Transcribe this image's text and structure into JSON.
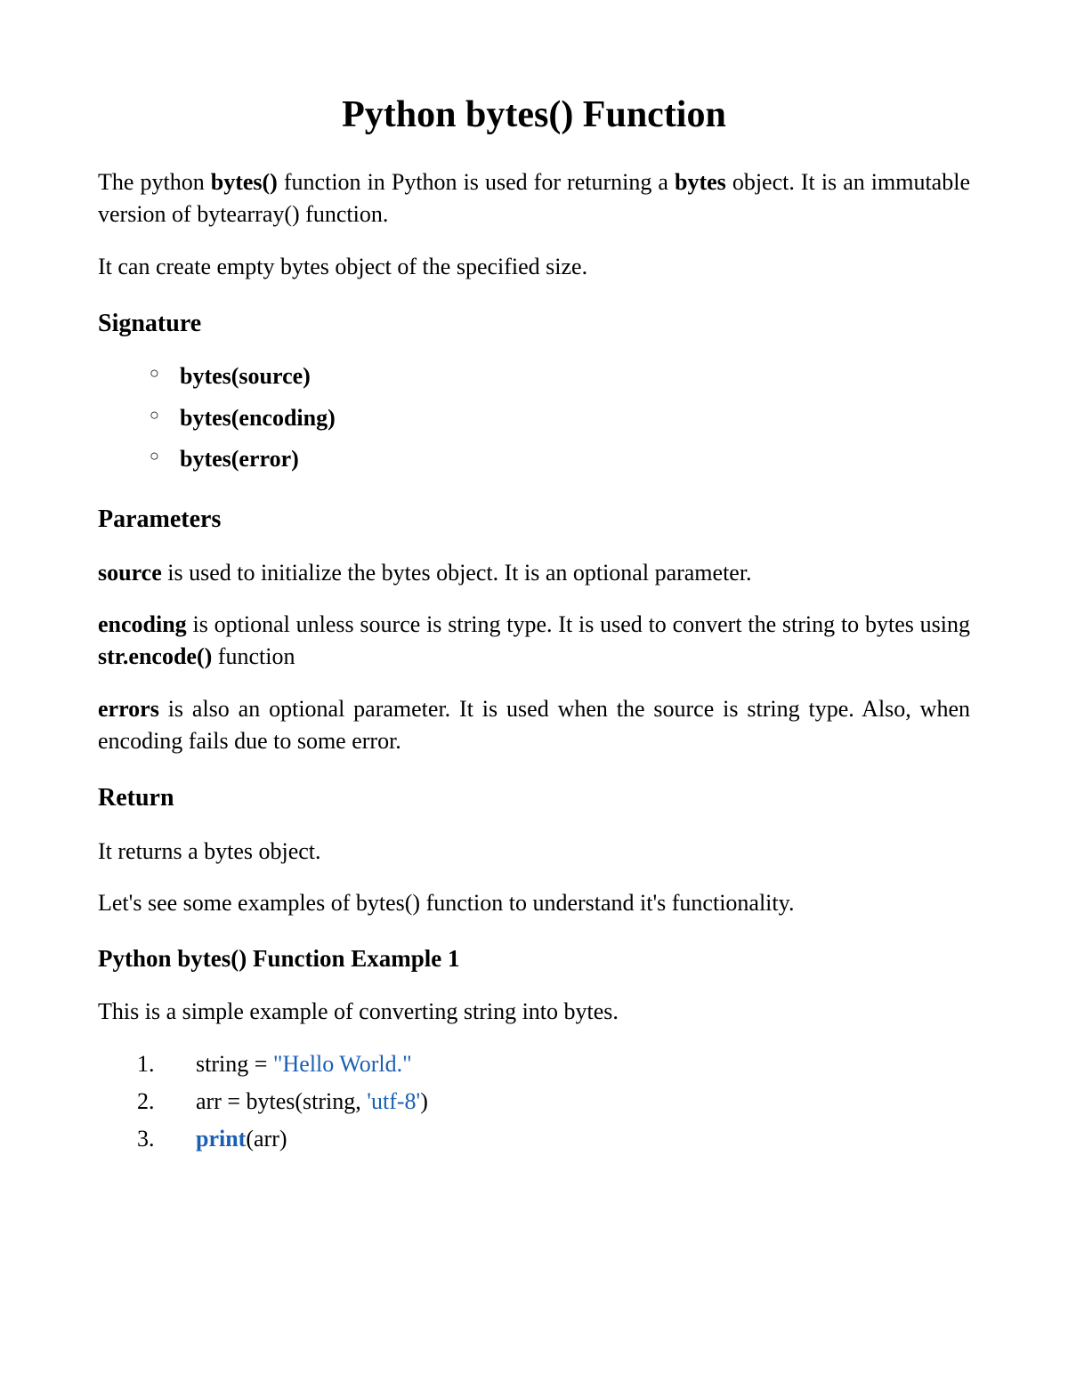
{
  "title": "Python bytes() Function",
  "intro": {
    "p1_pre": "The python ",
    "p1_bold1": "bytes()",
    "p1_mid": " function in Python is used for returning a ",
    "p1_bold2": "bytes",
    "p1_post": " object. It is an immutable version of bytearray() function.",
    "p2": "It can create empty bytes object of the specified size."
  },
  "signature": {
    "heading": "Signature",
    "items": [
      "bytes(source)",
      "bytes(encoding)",
      "bytes(error)"
    ]
  },
  "parameters": {
    "heading": "Parameters",
    "p1_bold": "source",
    "p1_text": " is used to initialize the bytes object. It is an optional parameter.",
    "p2_bold": "encoding",
    "p2_text1": " is optional unless source is string type. It is used to convert the string to bytes using ",
    "p2_bold2": "str.encode()",
    "p2_text2": " function",
    "p3_bold": "errors",
    "p3_text": " is also an optional parameter. It is used when the source is string type. Also, when encoding fails due to some error."
  },
  "return": {
    "heading": "Return",
    "p1": "It returns a bytes object.",
    "p2": "Let's see some examples of bytes() function to understand it's functionality."
  },
  "example1": {
    "heading": "Python bytes() Function Example 1",
    "desc": "This is a simple example of converting string into bytes.",
    "code": {
      "line1_pre": "string = ",
      "line1_str": "\"Hello World.\"",
      "line2_pre": "arr = bytes(string, ",
      "line2_str": "'utf-8'",
      "line2_post": ")",
      "line3_kw": "print",
      "line3_post": "(arr)"
    }
  }
}
